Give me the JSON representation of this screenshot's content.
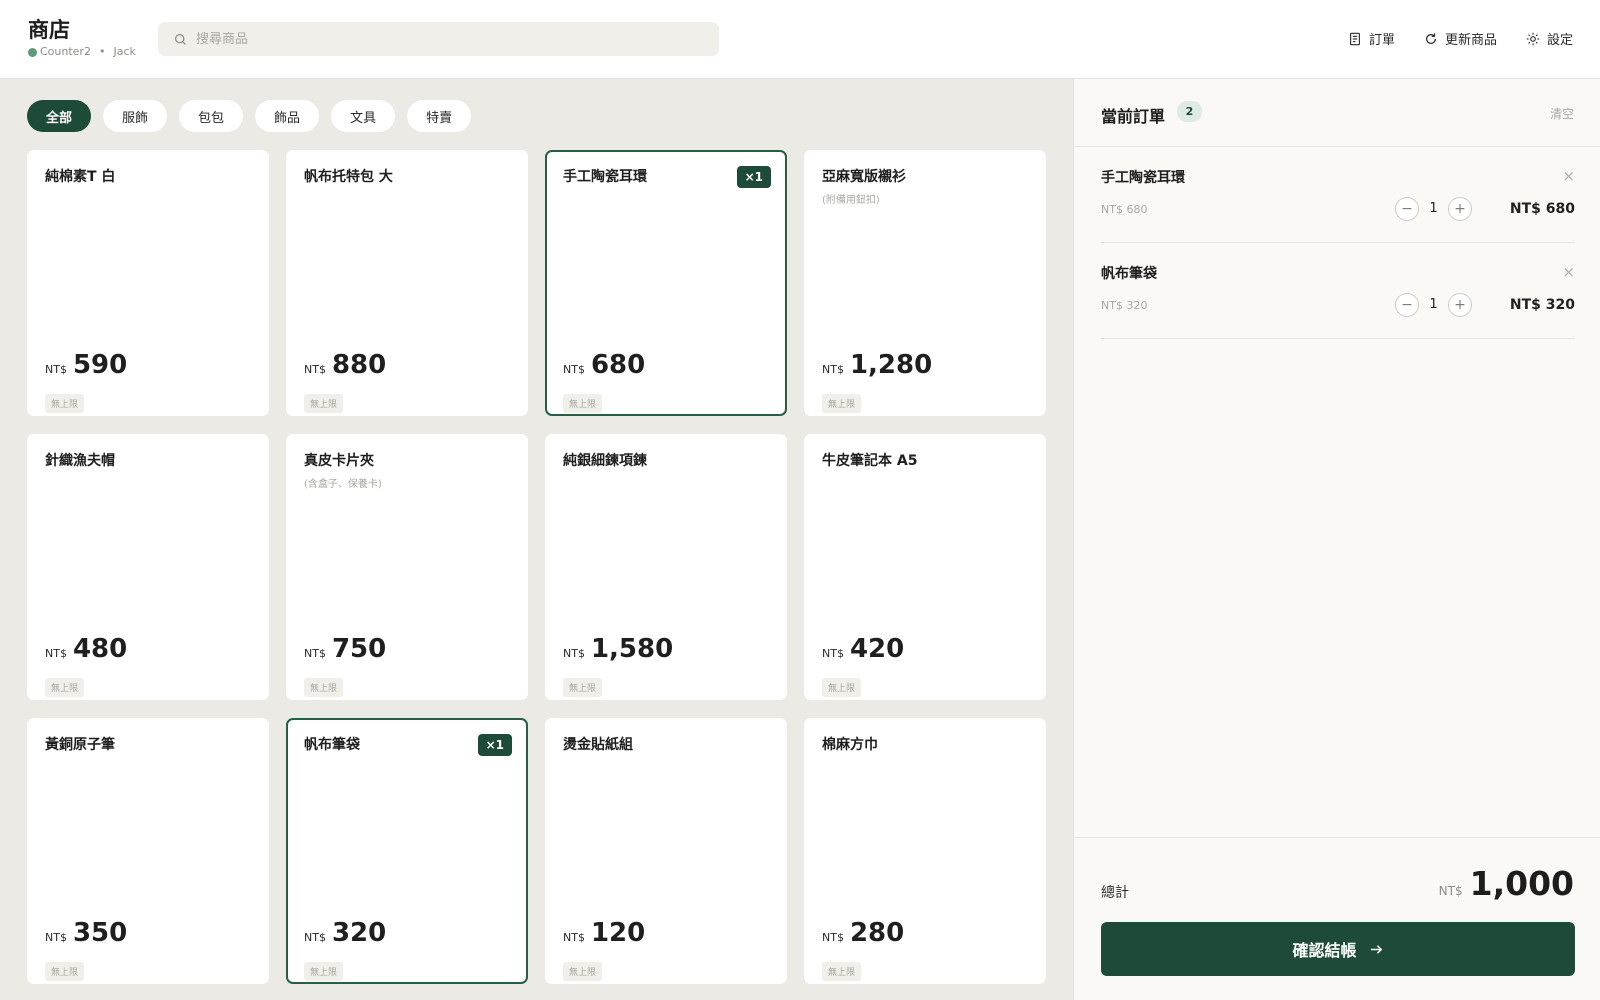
{
  "app": {
    "title": "商店",
    "counter": "Counter2",
    "separator": "•",
    "user": "Jack"
  },
  "search": {
    "placeholder": "搜尋商品",
    "value": ""
  },
  "header_actions": [
    {
      "label": "訂單",
      "icon": "receipt-icon"
    },
    {
      "label": "更新商品",
      "icon": "refresh-icon"
    },
    {
      "label": "設定",
      "icon": "gear-icon"
    }
  ],
  "categories": [
    {
      "label": "全部",
      "active": true
    },
    {
      "label": "服飾",
      "active": false
    },
    {
      "label": "包包",
      "active": false
    },
    {
      "label": "飾品",
      "active": false
    },
    {
      "label": "文具",
      "active": false
    },
    {
      "label": "特賣",
      "active": false
    }
  ],
  "products": [
    {
      "name": "純棉素T 白",
      "note": "",
      "currency": "NT$",
      "price": "590",
      "limit": "無上限",
      "in_cart": ""
    },
    {
      "name": "帆布托特包 大",
      "note": "",
      "currency": "NT$",
      "price": "880",
      "limit": "無上限",
      "in_cart": ""
    },
    {
      "name": "手工陶瓷耳環",
      "note": "",
      "currency": "NT$",
      "price": "680",
      "limit": "無上限",
      "in_cart": "×1"
    },
    {
      "name": "亞麻寬版襯衫",
      "note": "(附備用鈕扣)",
      "currency": "NT$",
      "price": "1,280",
      "limit": "無上限",
      "in_cart": ""
    },
    {
      "name": "針織漁夫帽",
      "note": "",
      "currency": "NT$",
      "price": "480",
      "limit": "無上限",
      "in_cart": ""
    },
    {
      "name": "真皮卡片夾",
      "note": "(含盒子、保養卡)",
      "currency": "NT$",
      "price": "750",
      "limit": "無上限",
      "in_cart": ""
    },
    {
      "name": "純銀細鍊項鍊",
      "note": "",
      "currency": "NT$",
      "price": "1,580",
      "limit": "無上限",
      "in_cart": ""
    },
    {
      "name": "牛皮筆記本 A5",
      "note": "",
      "currency": "NT$",
      "price": "420",
      "limit": "無上限",
      "in_cart": ""
    },
    {
      "name": "黃銅原子筆",
      "note": "",
      "currency": "NT$",
      "price": "350",
      "limit": "無上限",
      "in_cart": ""
    },
    {
      "name": "帆布筆袋",
      "note": "",
      "currency": "NT$",
      "price": "320",
      "limit": "無上限",
      "in_cart": "×1"
    },
    {
      "name": "燙金貼紙組",
      "note": "",
      "currency": "NT$",
      "price": "120",
      "limit": "無上限",
      "in_cart": ""
    },
    {
      "name": "棉麻方巾",
      "note": "",
      "currency": "NT$",
      "price": "280",
      "limit": "無上限",
      "in_cart": ""
    }
  ],
  "order": {
    "title": "當前訂單",
    "count": "2",
    "clear_label": "清空",
    "items": [
      {
        "name": "手工陶瓷耳環",
        "unit_price": "NT$ 680",
        "qty": "1",
        "total": "NT$ 680",
        "remove_glyph": "×",
        "minus_glyph": "−",
        "plus_glyph": "+"
      },
      {
        "name": "帆布筆袋",
        "unit_price": "NT$ 320",
        "qty": "1",
        "total": "NT$ 320",
        "remove_glyph": "×",
        "minus_glyph": "−",
        "plus_glyph": "+"
      }
    ],
    "total_label": "總計",
    "total_currency": "NT$",
    "total_amount": "1,000",
    "checkout_label": "確認結帳"
  },
  "colors": {
    "accent": "#1e4b37",
    "status_online": "#5d9a78",
    "background": "#ebeae5"
  }
}
